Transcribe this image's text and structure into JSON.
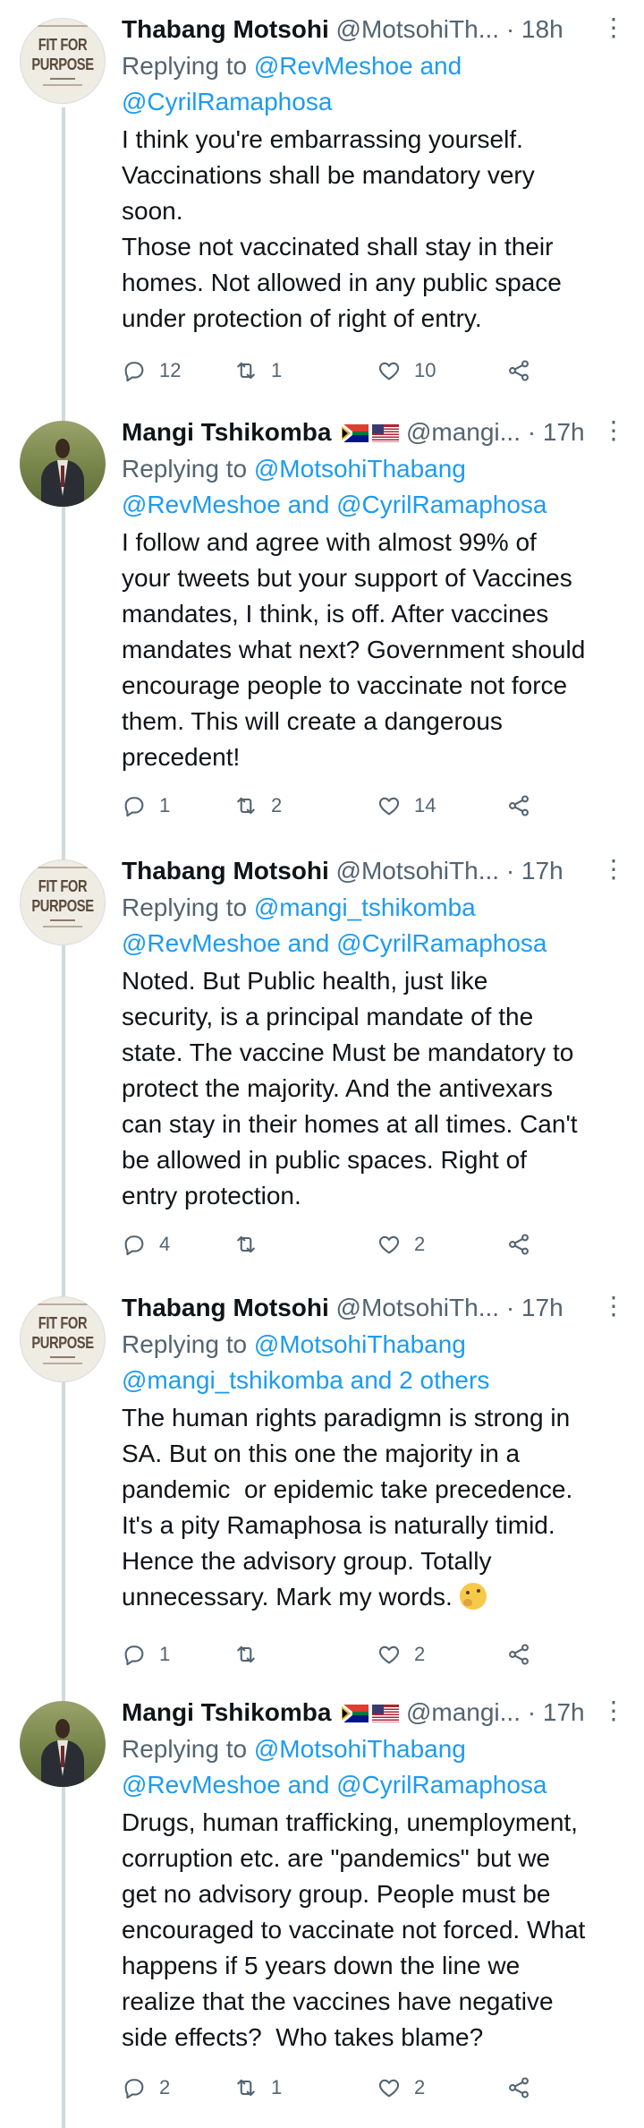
{
  "tweets": [
    {
      "avatar": "fit-for-purpose-logo",
      "avatar_text": [
        "FIT FOR",
        "PURPOSE"
      ],
      "name": "Thabang Motsohi",
      "handle": "@MotsohiTh...",
      "dot": "·",
      "time": "18h",
      "replying_prefix": "Replying to ",
      "replying_line1_link": "@RevMeshoe and",
      "replying_line2_link": "@CyrilRamaphosa",
      "replying_line2_text": "",
      "text": "I think you're embarrassing yourself.\nVaccinations shall be mandatory very\nsoon.\nThose not vaccinated shall stay in their\nhomes. Not allowed in any public space\nunder protection of right of entry.",
      "replies": "12",
      "retweets": "1",
      "likes": "10"
    },
    {
      "avatar": "person-photo",
      "name": "Mangi Tshikomba",
      "flags": [
        "south-africa-flag",
        "usa-flag"
      ],
      "handle": "@mangi...",
      "dot": "·",
      "time": "17h",
      "replying_prefix": "Replying to ",
      "replying_line1_link": "@MotsohiThabang",
      "replying_line2_link": "@RevMeshoe and @CyrilRamaphosa",
      "replying_line2_text": "",
      "text": "I follow and agree with almost 99% of\nyour tweets but your support of Vaccines\nmandates, I think, is off. After vaccines\nmandates what next? Government should\nencourage people to vaccinate not force\nthem. This will create a dangerous\nprecedent!",
      "replies": "1",
      "retweets": "2",
      "likes": "14"
    },
    {
      "avatar": "fit-for-purpose-logo",
      "avatar_text": [
        "FIT FOR",
        "PURPOSE"
      ],
      "name": "Thabang Motsohi",
      "handle": "@MotsohiTh...",
      "dot": "·",
      "time": "17h",
      "replying_prefix": "Replying to ",
      "replying_line1_link": "@mangi_tshikomba",
      "replying_line2_link": "@RevMeshoe and @CyrilRamaphosa",
      "replying_line2_text": "",
      "text": "Noted. But Public health, just like\nsecurity, is a principal mandate of the\nstate. The vaccine Must be mandatory to\nprotect the majority. And the antivexars\ncan stay in their homes at all times. Can't\nbe allowed in public spaces. Right of\nentry protection.",
      "replies": "4",
      "retweets": "",
      "likes": "2"
    },
    {
      "avatar": "fit-for-purpose-logo",
      "avatar_text": [
        "FIT FOR",
        "PURPOSE"
      ],
      "name": "Thabang Motsohi",
      "handle": "@MotsohiTh...",
      "dot": "·",
      "time": "17h",
      "replying_prefix": "Replying to ",
      "replying_line1_link": "@MotsohiThabang",
      "replying_line2_link": "@mangi_tshikomba and 2 others",
      "replying_line2_text": "",
      "text": "The human rights paradigmn is strong in\nSA. But on this one the majority in a\npandemic  or epidemic take precedence.\nIt's a pity Ramaphosa is naturally timid.\nHence the advisory group. Totally\nunnecessary. Mark my words. ",
      "emoji": "thinking-face-emoji",
      "replies": "1",
      "retweets": "",
      "likes": "2"
    },
    {
      "avatar": "person-photo",
      "name": "Mangi Tshikomba",
      "flags": [
        "south-africa-flag",
        "usa-flag"
      ],
      "handle": "@mangi...",
      "dot": "·",
      "time": "17h",
      "replying_prefix": "Replying to ",
      "replying_line1_link": "@MotsohiThabang",
      "replying_line2_link": "@RevMeshoe and @CyrilRamaphosa",
      "replying_line2_text": "",
      "text": "Drugs, human trafficking, unemployment,\ncorruption etc. are \"pandemics\" but we\nget no advisory group. People must be\nencouraged to vaccinate not forced. What\nhappens if 5 years down the line we\nrealize that the vaccines have negative\nside effects?  Who takes blame?",
      "replies": "2",
      "retweets": "1",
      "likes": "2"
    }
  ],
  "more_glyph": "⋮",
  "colors": {
    "link": "#1d9bf0",
    "muted": "#536471",
    "text": "#0f1419",
    "thread": "#cfd9de"
  }
}
